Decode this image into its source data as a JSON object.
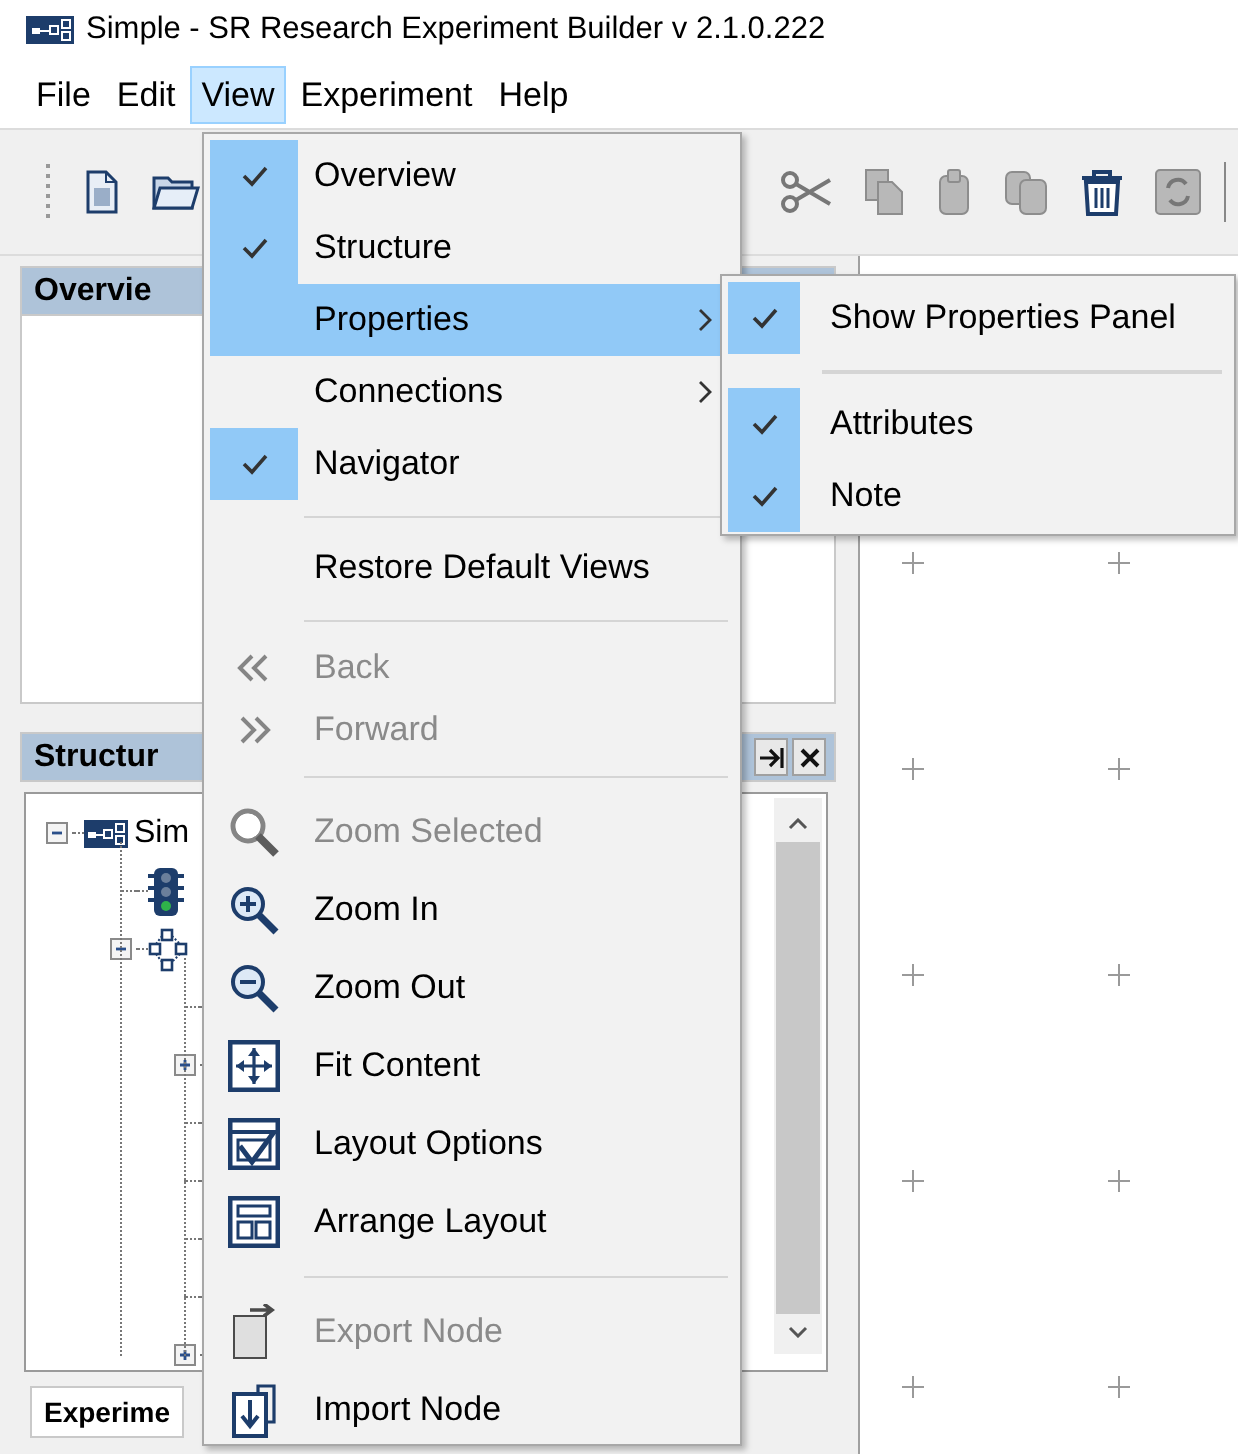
{
  "window": {
    "title": "Simple - SR Research Experiment Builder v 2.1.0.222"
  },
  "menu_bar": [
    {
      "label": "File",
      "selected": false
    },
    {
      "label": "Edit",
      "selected": false
    },
    {
      "label": "View",
      "selected": true
    },
    {
      "label": "Experiment",
      "selected": false
    },
    {
      "label": "Help",
      "selected": false
    }
  ],
  "overview_panel": {
    "title": "Overvie"
  },
  "structure_panel": {
    "title": "Structur",
    "tree": [
      {
        "label": "Sim",
        "expandable": true,
        "expanded": true,
        "children": [
          {
            "expandable": false
          },
          {
            "expandable": true,
            "expanded": true,
            "children": [
              {
                "expandable": false
              },
              {
                "expandable": true,
                "expanded": false
              },
              {
                "expandable": false
              },
              {
                "expandable": false
              },
              {
                "expandable": false
              },
              {
                "expandable": false
              },
              {
                "expandable": true,
                "expanded": false
              }
            ]
          }
        ]
      }
    ]
  },
  "bottom_tabs": [
    {
      "label": "Experime",
      "selected": true
    }
  ],
  "view_menu": {
    "items": [
      {
        "kind": "check",
        "label": "Overview",
        "checked": true,
        "disabled": false,
        "selected": false,
        "has_submenu": false
      },
      {
        "kind": "check",
        "label": "Structure",
        "checked": true,
        "disabled": false,
        "selected": false,
        "has_submenu": false
      },
      {
        "kind": "check",
        "label": "Properties",
        "checked": false,
        "disabled": false,
        "selected": true,
        "has_submenu": true
      },
      {
        "kind": "check",
        "label": "Connections",
        "checked": false,
        "disabled": false,
        "selected": false,
        "has_submenu": true
      },
      {
        "kind": "check",
        "label": "Navigator",
        "checked": true,
        "disabled": false,
        "selected": false,
        "has_submenu": false
      },
      {
        "kind": "separator"
      },
      {
        "kind": "check",
        "label": "Restore Default Views",
        "checked": false,
        "disabled": false,
        "selected": false,
        "has_submenu": false
      },
      {
        "kind": "separator"
      },
      {
        "kind": "nav",
        "label": "Back",
        "checked": false,
        "disabled": true,
        "selected": false,
        "has_submenu": false
      },
      {
        "kind": "nav",
        "label": "Forward",
        "checked": false,
        "disabled": true,
        "selected": false,
        "has_submenu": false
      },
      {
        "kind": "separator"
      },
      {
        "kind": "icon",
        "label": "Zoom Selected",
        "checked": false,
        "disabled": true,
        "selected": false,
        "has_submenu": false
      },
      {
        "kind": "icon",
        "label": "Zoom In",
        "checked": false,
        "disabled": false,
        "selected": false,
        "has_submenu": false
      },
      {
        "kind": "icon",
        "label": "Zoom Out",
        "checked": false,
        "disabled": false,
        "selected": false,
        "has_submenu": false
      },
      {
        "kind": "icon",
        "label": "Fit Content",
        "checked": false,
        "disabled": false,
        "selected": false,
        "has_submenu": false
      },
      {
        "kind": "icon",
        "label": "Layout Options",
        "checked": false,
        "disabled": false,
        "selected": false,
        "has_submenu": false
      },
      {
        "kind": "icon",
        "label": "Arrange Layout",
        "checked": false,
        "disabled": false,
        "selected": false,
        "has_submenu": false
      },
      {
        "kind": "separator"
      },
      {
        "kind": "icon",
        "label": "Export Node",
        "checked": false,
        "disabled": true,
        "selected": false,
        "has_submenu": false
      },
      {
        "kind": "icon",
        "label": "Import Node",
        "checked": false,
        "disabled": false,
        "selected": false,
        "has_submenu": false
      }
    ]
  },
  "properties_submenu": {
    "items": [
      {
        "kind": "check",
        "label": "Show Properties Panel",
        "checked": true
      },
      {
        "kind": "separator"
      },
      {
        "kind": "check",
        "label": "Attributes",
        "checked": true
      },
      {
        "kind": "check",
        "label": "Note",
        "checked": true
      }
    ]
  }
}
